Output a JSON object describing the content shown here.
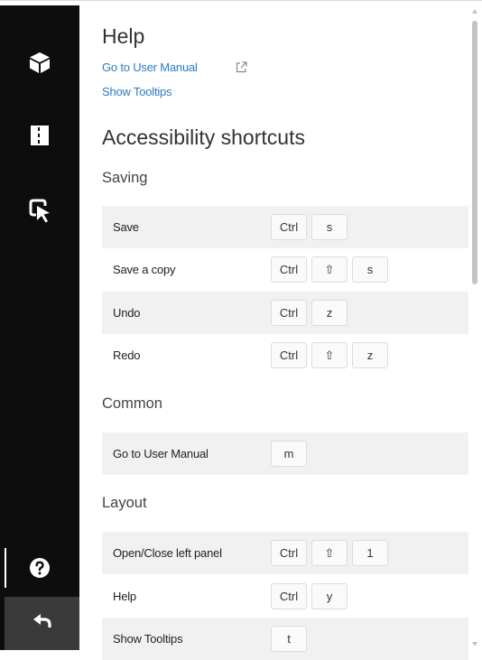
{
  "help": {
    "title": "Help",
    "manual_link": "Go to User Manual",
    "tooltips_link": "Show Tooltips"
  },
  "accessibility": {
    "title": "Accessibility shortcuts"
  },
  "sections": {
    "saving": "Saving",
    "common": "Common",
    "layout": "Layout"
  },
  "shortcuts": {
    "save": {
      "label": "Save",
      "keys": [
        "Ctrl",
        "s"
      ]
    },
    "save_copy": {
      "label": "Save a copy",
      "keys": [
        "Ctrl",
        "⇧",
        "s"
      ]
    },
    "undo": {
      "label": "Undo",
      "keys": [
        "Ctrl",
        "z"
      ]
    },
    "redo": {
      "label": "Redo",
      "keys": [
        "Ctrl",
        "⇧",
        "z"
      ]
    },
    "user_manual": {
      "label": "Go to User Manual",
      "keys": [
        "m"
      ]
    },
    "left_panel": {
      "label": "Open/Close left panel",
      "keys": [
        "Ctrl",
        "⇧",
        "1"
      ]
    },
    "help": {
      "label": "Help",
      "keys": [
        "Ctrl",
        "y"
      ]
    },
    "tooltips": {
      "label": "Show Tooltips",
      "keys": [
        "t"
      ]
    }
  },
  "sidebar": {
    "items": [
      {
        "icon": "cube-icon"
      },
      {
        "icon": "panels-icon"
      },
      {
        "icon": "select-cursor-icon"
      },
      {
        "icon": "help-circle-icon",
        "active": true
      },
      {
        "icon": "back-arrow-icon"
      }
    ]
  },
  "colors": {
    "sidebar": "#0d0d0d",
    "link": "#2b7bc0",
    "row_shade": "#f1f1f1"
  }
}
